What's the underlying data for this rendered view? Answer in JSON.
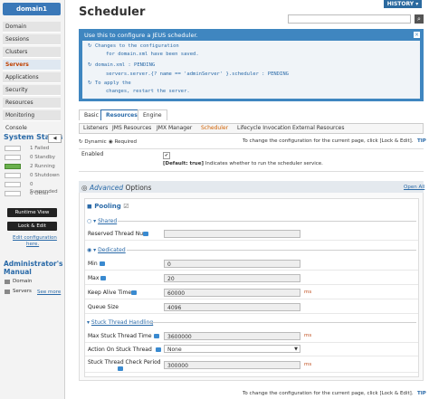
{
  "sidebar": {
    "domain": "domain1",
    "nav": [
      "Domain",
      "Sessions",
      "Clusters",
      "Servers",
      "Applications",
      "Security",
      "Resources",
      "Monitoring",
      "Console"
    ],
    "active_nav": "Servers",
    "status_title": "System Status",
    "status_button": "◀",
    "status_rows": [
      {
        "label": "1 Failed",
        "on": false
      },
      {
        "label": "0 Standby",
        "on": false
      },
      {
        "label": "2 Running",
        "on": true
      },
      {
        "label": "0 Shutdown",
        "on": false
      },
      {
        "label": "0 Suspended",
        "on": false
      },
      {
        "label": "0 Other",
        "on": false
      }
    ],
    "runtime_view": "Runtime View",
    "lock_edit": "Lock & Edit",
    "edit_config_1": "Edit configuration",
    "edit_config_2": "here.",
    "admin_manual_1": "Administrator's",
    "admin_manual_2": "Manual",
    "manual_domain": "Domain",
    "manual_servers": "Servers",
    "see_more": "See more"
  },
  "header": {
    "title": "Scheduler",
    "history": "HISTORY ▾"
  },
  "info": {
    "heading": "Use this to configure a JEUS scheduler.",
    "lines": [
      "Changes to the configuration",
      "for domain.xml have been saved.",
      "domain.xml : PENDING",
      "servers.server.{? name == 'adminServer' }.scheduler : PENDING",
      "To apply the",
      "changes, restart the server."
    ]
  },
  "tabs_top": [
    "Basic",
    "Resources",
    "Engine"
  ],
  "tabs_top_active": "Resources",
  "tabs_sub": [
    "Listeners",
    "JMS Resources",
    "JMX Manager",
    "Scheduler",
    "Lifecycle Invocation",
    "External Resources"
  ],
  "tabs_sub_active": "Scheduler",
  "mode": {
    "dynamic": "Dynamic",
    "required": "Required"
  },
  "note": "To change the configuration for the current page, click [Lock & Edit].",
  "tip": "TIP",
  "enabled": {
    "label": "Enabled",
    "check": "✔",
    "default_tag": "[Default: true]",
    "desc": "Indicates whether to run the scheduler service."
  },
  "advanced": {
    "word": "Advanced",
    "options": "Options",
    "open_all": "Open All",
    "pooling": "Pooling",
    "shared": "Shared",
    "dedicated": "Dedicated",
    "stuck_handling": "Stuck Thread Handling"
  },
  "fields": {
    "reserved": {
      "label": "Reserved Thread Num",
      "value": ""
    },
    "min": {
      "label": "Min",
      "value": "0"
    },
    "max": {
      "label": "Max",
      "value": "20"
    },
    "keep_alive": {
      "label": "Keep Alive Time",
      "value": "60000",
      "unit": "ms"
    },
    "queue_size": {
      "label": "Queue Size",
      "value": "4096"
    },
    "max_stuck": {
      "label": "Max Stuck Thread Time",
      "value": "3600000",
      "unit": "ms"
    },
    "action_on_stuck": {
      "label": "Action On Stuck Thread",
      "value": "None"
    },
    "stuck_period": {
      "label": "Stuck Thread Check Period",
      "value": "300000",
      "unit": "ms"
    }
  }
}
